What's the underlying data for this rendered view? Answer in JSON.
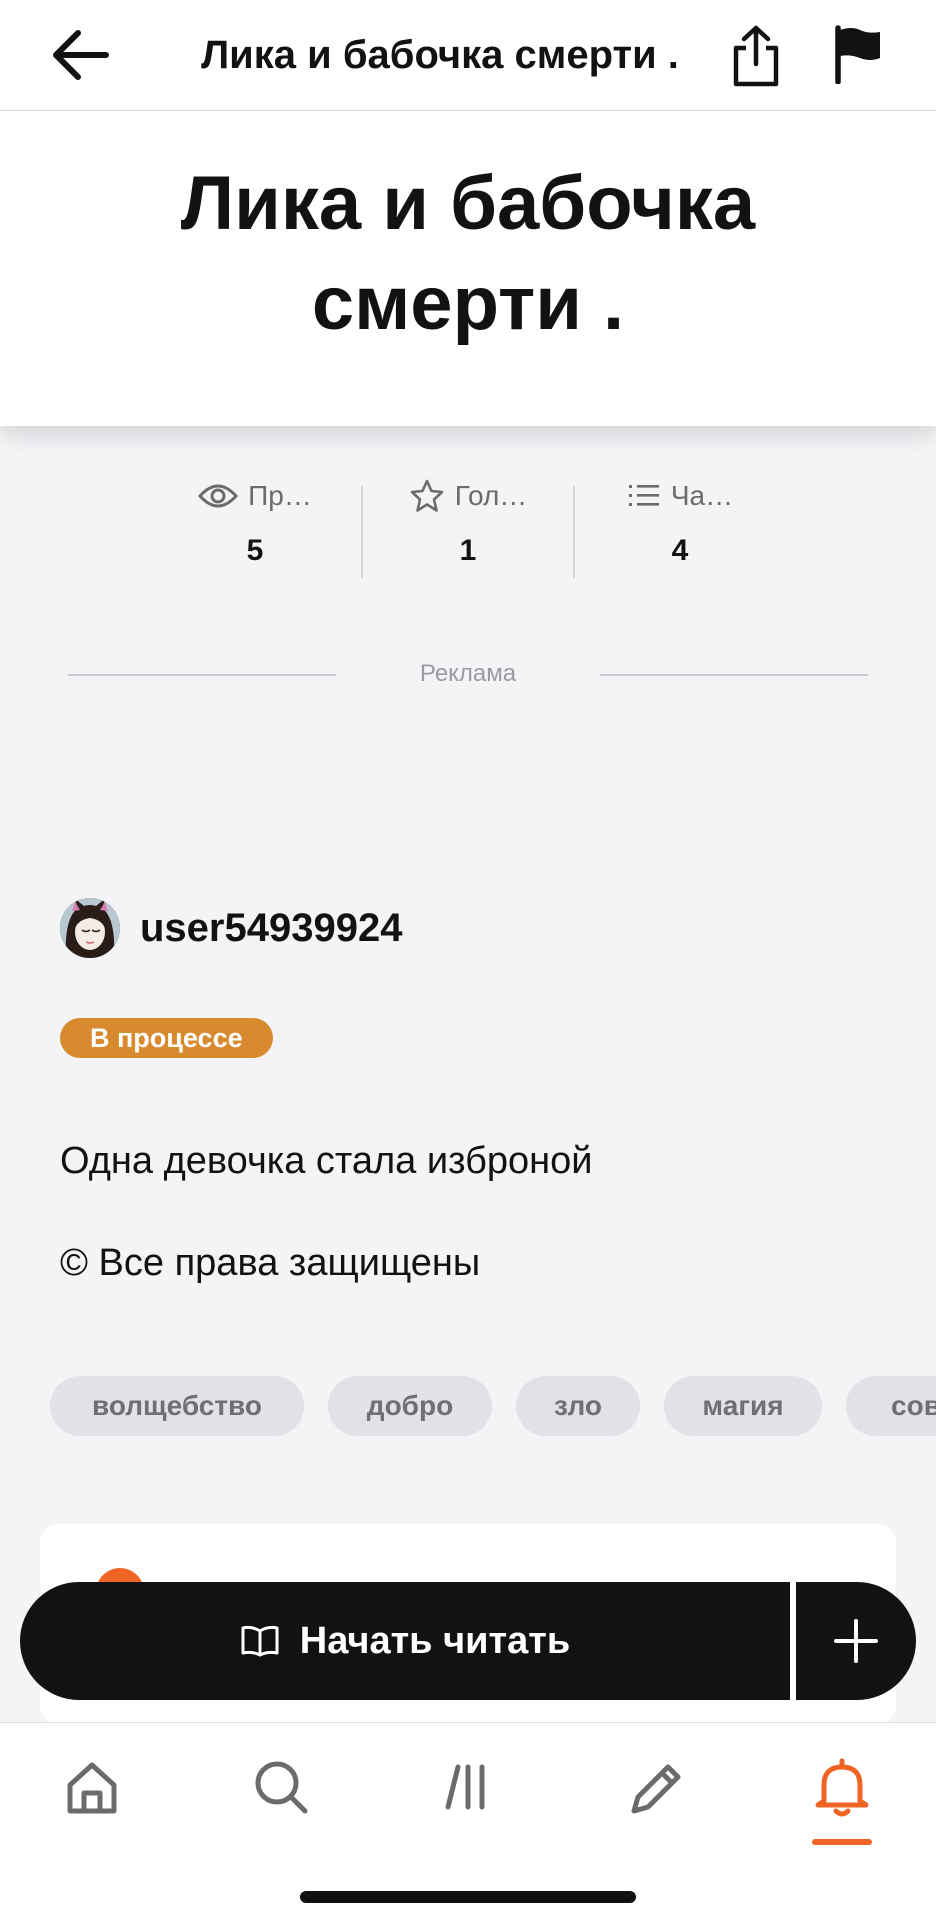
{
  "topbar": {
    "title": "Лика  и бабочка смерти ."
  },
  "story": {
    "title": "Лика  и бабочка смерти ."
  },
  "stats": [
    {
      "label": "Пр…",
      "value": "5",
      "icon": "eye-icon"
    },
    {
      "label": "Гол…",
      "value": "1",
      "icon": "star-icon"
    },
    {
      "label": "Ча…",
      "value": "4",
      "icon": "list-icon"
    }
  ],
  "ad": {
    "label": "Реклама"
  },
  "author": {
    "name": "user54939924"
  },
  "status": {
    "label": "В процессе",
    "color": "#d88a2e"
  },
  "description": "Одна девочка стала изброной",
  "copyright": "© Все права защищены",
  "tags": [
    "волщебство",
    "добро",
    "зло",
    "магия",
    "сов"
  ],
  "read_button": {
    "label": "Начать читать"
  },
  "nav": {
    "items": [
      "home-icon",
      "search-icon",
      "library-icon",
      "write-icon",
      "notifications-icon"
    ],
    "active": "notifications-icon",
    "accent": "#f06423"
  }
}
